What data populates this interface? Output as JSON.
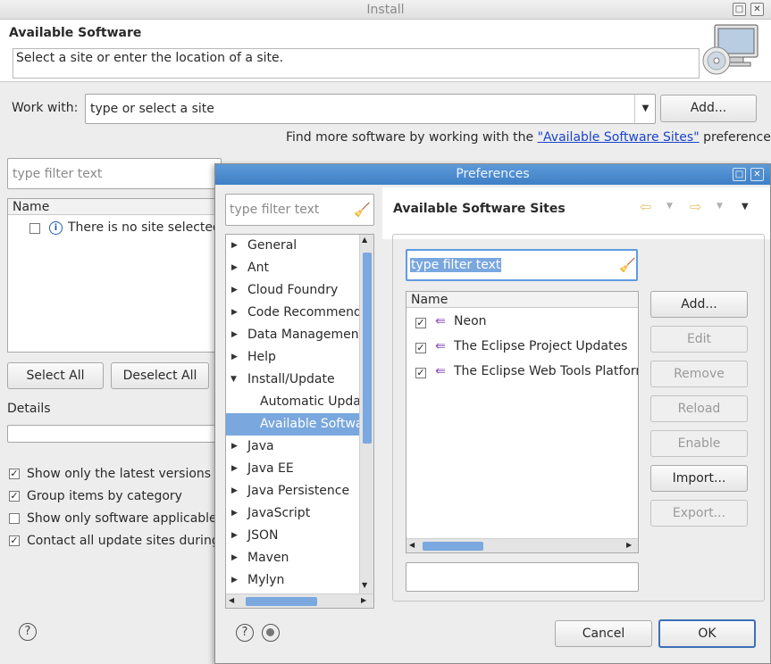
{
  "install": {
    "title": "Install",
    "heading": "Available Software",
    "message": "Select a site or enter the location of a site.",
    "work_with_label": "Work with:",
    "work_with_value": "type or select a site",
    "add_label": "Add...",
    "find_more_prefix": "Find more software by working with the ",
    "find_more_link": "\"Available Software Sites\"",
    "find_more_suffix": " preferences.",
    "filter_placeholder": "type filter text",
    "name_header": "Name",
    "no_site": "There is no site selected.",
    "select_all": "Select All",
    "deselect_all": "Deselect All",
    "details_label": "Details",
    "options": [
      {
        "label": "Show only the latest versions of",
        "checked": true
      },
      {
        "label": "Group items by category",
        "checked": true
      },
      {
        "label": "Show only software applicable t",
        "checked": false
      },
      {
        "label": "Contact all update sites during i",
        "checked": true
      }
    ]
  },
  "prefs": {
    "title": "Preferences",
    "filter_placeholder": "type filter text",
    "tree": [
      {
        "label": "General",
        "expandable": true
      },
      {
        "label": "Ant",
        "expandable": true
      },
      {
        "label": "Cloud Foundry",
        "expandable": true
      },
      {
        "label": "Code Recommende",
        "expandable": true
      },
      {
        "label": "Data Management",
        "expandable": true
      },
      {
        "label": "Help",
        "expandable": true
      },
      {
        "label": "Install/Update",
        "expandable": true,
        "expanded": true
      },
      {
        "label": "Automatic Updat",
        "child": true
      },
      {
        "label": "Available Softwa",
        "child": true,
        "selected": true
      },
      {
        "label": "Java",
        "expandable": true
      },
      {
        "label": "Java EE",
        "expandable": true
      },
      {
        "label": "Java Persistence",
        "expandable": true
      },
      {
        "label": "JavaScript",
        "expandable": true
      },
      {
        "label": "JSON",
        "expandable": true
      },
      {
        "label": "Maven",
        "expandable": true
      },
      {
        "label": "Mylyn",
        "expandable": true
      }
    ],
    "page_title": "Available Software Sites",
    "sites_filter_value": "type filter text",
    "sites_header": "Name",
    "sites": [
      {
        "name": "Neon",
        "checked": true
      },
      {
        "name": "The Eclipse Project Updates",
        "checked": true
      },
      {
        "name": "The Eclipse Web Tools Platform",
        "checked": true
      }
    ],
    "buttons": {
      "add": "Add...",
      "edit": "Edit",
      "remove": "Remove",
      "reload": "Reload",
      "enable": "Enable",
      "import": "Import...",
      "export": "Export..."
    },
    "cancel": "Cancel",
    "ok": "OK"
  },
  "colors": {
    "accent": "#3f8ed6",
    "selection": "#79a7de",
    "link": "#1a44cc",
    "ok_border": "#3b6fb5"
  }
}
